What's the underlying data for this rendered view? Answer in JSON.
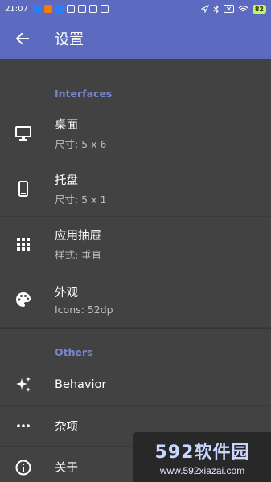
{
  "statusbar": {
    "time": "21:07",
    "battery": "82"
  },
  "appbar": {
    "title": "设置",
    "back_icon": "arrow-back-icon"
  },
  "sections": {
    "interfaces": "Interfaces",
    "others": "Others"
  },
  "items": {
    "desktop": {
      "title": "桌面",
      "subtitle": "尺寸: 5 x 6",
      "icon": "monitor-icon"
    },
    "dock": {
      "title": "托盘",
      "subtitle": "尺寸: 5 x 1",
      "icon": "phone-icon"
    },
    "drawer": {
      "title": "应用抽屉",
      "subtitle": "样式: 垂直",
      "icon": "grid-icon"
    },
    "appearance": {
      "title": "外观",
      "subtitle": "Icons: 52dp",
      "icon": "palette-icon"
    },
    "behavior": {
      "title": "Behavior",
      "icon": "sparkle-icon"
    },
    "misc": {
      "title": "杂项",
      "icon": "more-horiz-icon"
    },
    "about": {
      "title": "关于",
      "icon": "info-icon"
    }
  },
  "watermark": {
    "logo": "592软件园",
    "url": "www.592xiazai.com"
  },
  "colors": {
    "primary": "#5c6bc0",
    "accent": "#7986cb",
    "background": "#424242"
  }
}
